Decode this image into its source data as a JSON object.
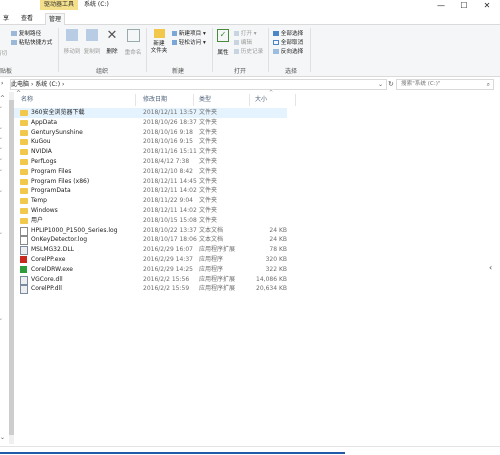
{
  "window": {
    "context_tab": "驱动器工具",
    "title": "系统 (C:)",
    "minimize": "—",
    "maximize": "☐",
    "close": "✕"
  },
  "tabs": [
    {
      "label": "享"
    },
    {
      "label": "查看"
    },
    {
      "label": "管理",
      "active": true
    }
  ],
  "ribbon": {
    "clipboard": {
      "copy_path": "复制路径",
      "paste_shortcut": "粘贴快捷方式",
      "cut": "剪切",
      "label": "贴板"
    },
    "organize": {
      "move_to": "移动到",
      "copy_to": "复制到",
      "delete": "删除",
      "rename": "重命名",
      "label": "组织"
    },
    "new": {
      "new_folder": "新建\n文件夹",
      "new_item": "新建项目",
      "easy_access": "轻松访问",
      "label": "新建"
    },
    "open": {
      "properties": "属性",
      "open": "打开",
      "edit": "编辑",
      "history": "历史记录",
      "label": "打开"
    },
    "select": {
      "select_all": "全部选择",
      "select_none": "全部取消",
      "invert": "反向选择",
      "label": "选择"
    }
  },
  "address": {
    "path_this_pc": "此电脑",
    "path_drive": "系统 (C:)",
    "sep": "›",
    "search_placeholder": "搜索\"系统 (C:)\""
  },
  "columns": {
    "name": "名称",
    "date": "修改日期",
    "type": "类型",
    "size": "大小"
  },
  "files": [
    {
      "name": "360安全浏览器下载",
      "date": "2018/12/11 13:57",
      "type": "文件夹",
      "size": "",
      "icon": "folder",
      "selected": true
    },
    {
      "name": "AppData",
      "date": "2018/10/26 18:37",
      "type": "文件夹",
      "size": "",
      "icon": "folder"
    },
    {
      "name": "GenturySunshine",
      "date": "2018/10/16 9:18",
      "type": "文件夹",
      "size": "",
      "icon": "folder"
    },
    {
      "name": "KuGou",
      "date": "2018/10/16 9:15",
      "type": "文件夹",
      "size": "",
      "icon": "folder"
    },
    {
      "name": "NVIDIA",
      "date": "2018/11/16 15:11",
      "type": "文件夹",
      "size": "",
      "icon": "folder"
    },
    {
      "name": "PerfLogs",
      "date": "2018/4/12 7:38",
      "type": "文件夹",
      "size": "",
      "icon": "folder"
    },
    {
      "name": "Program Files",
      "date": "2018/12/10 8:42",
      "type": "文件夹",
      "size": "",
      "icon": "folder"
    },
    {
      "name": "Program Files (x86)",
      "date": "2018/12/11 14:45",
      "type": "文件夹",
      "size": "",
      "icon": "folder"
    },
    {
      "name": "ProgramData",
      "date": "2018/12/11 14:02",
      "type": "文件夹",
      "size": "",
      "icon": "folder"
    },
    {
      "name": "Temp",
      "date": "2018/11/22 9:04",
      "type": "文件夹",
      "size": "",
      "icon": "folder"
    },
    {
      "name": "Windows",
      "date": "2018/12/11 14:02",
      "type": "文件夹",
      "size": "",
      "icon": "folder"
    },
    {
      "name": "用户",
      "date": "2018/10/15 15:08",
      "type": "文件夹",
      "size": "",
      "icon": "folder"
    },
    {
      "name": "HPLIP1000_P1500_Series.log",
      "date": "2018/10/22 13:37",
      "type": "文本文档",
      "size": "24 KB",
      "icon": "doc"
    },
    {
      "name": "OnKeyDetector.log",
      "date": "2018/10/17 18:06",
      "type": "文本文档",
      "size": "24 KB",
      "icon": "doc"
    },
    {
      "name": "MSLMG32.DLL",
      "date": "2016/2/29 16:07",
      "type": "应用程序扩展",
      "size": "78 KB",
      "icon": "dll"
    },
    {
      "name": "CorelPP.exe",
      "date": "2016/2/29 14:37",
      "type": "应用程序",
      "size": "320 KB",
      "icon": "exe-red"
    },
    {
      "name": "CorelDRW.exe",
      "date": "2016/2/29 14:25",
      "type": "应用程序",
      "size": "322 KB",
      "icon": "exe-green"
    },
    {
      "name": "VGCore.dll",
      "date": "2016/2/2 15:56",
      "type": "应用程序扩展",
      "size": "14,086 KB",
      "icon": "dll"
    },
    {
      "name": "CorelPP.dll",
      "date": "2016/2/2 15:59",
      "type": "应用程序扩展",
      "size": "20,634 KB",
      "icon": "dll"
    }
  ]
}
